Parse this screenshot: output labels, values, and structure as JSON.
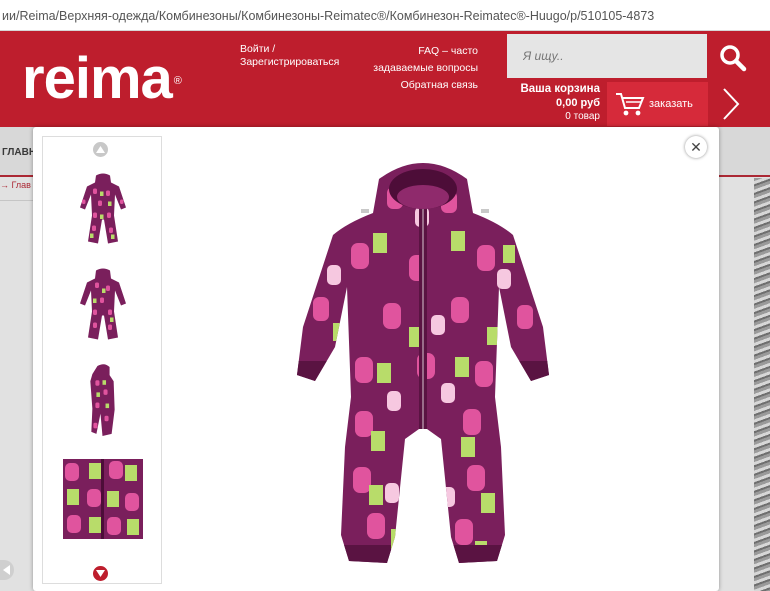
{
  "address_bar": {
    "url": "ии/Reima/Верхняя-одежда/Комбинезоны/Комбинезоны-Reimatec®/Комбинезон-Reimatec®-Huugo/p/510105-4873"
  },
  "header": {
    "logo": "reima",
    "logo_mark": "®",
    "login": "Войти /",
    "register": "Зарегистрироваться",
    "faq_line1": "FAQ – часто",
    "faq_line2": "задаваемые вопросы",
    "feedback": "Обратная связь",
    "search_placeholder": "Я ищу..",
    "cart_title": "Ваша корзина",
    "cart_sum": "0,00 руб",
    "cart_count": "0 товар",
    "order_label": "заказать"
  },
  "nav": {
    "home": "ГЛАВН",
    "breadcrumb": "→ Глав"
  },
  "gallery": {
    "thumbnails": [
      "front-view",
      "back-view",
      "side-view",
      "fabric-detail"
    ],
    "selected_index": 0
  },
  "colors": {
    "brand_red": "#be1e2d",
    "suit_purple": "#7a1f5c",
    "suit_pink": "#e0549e",
    "suit_green": "#b8dc6a"
  }
}
